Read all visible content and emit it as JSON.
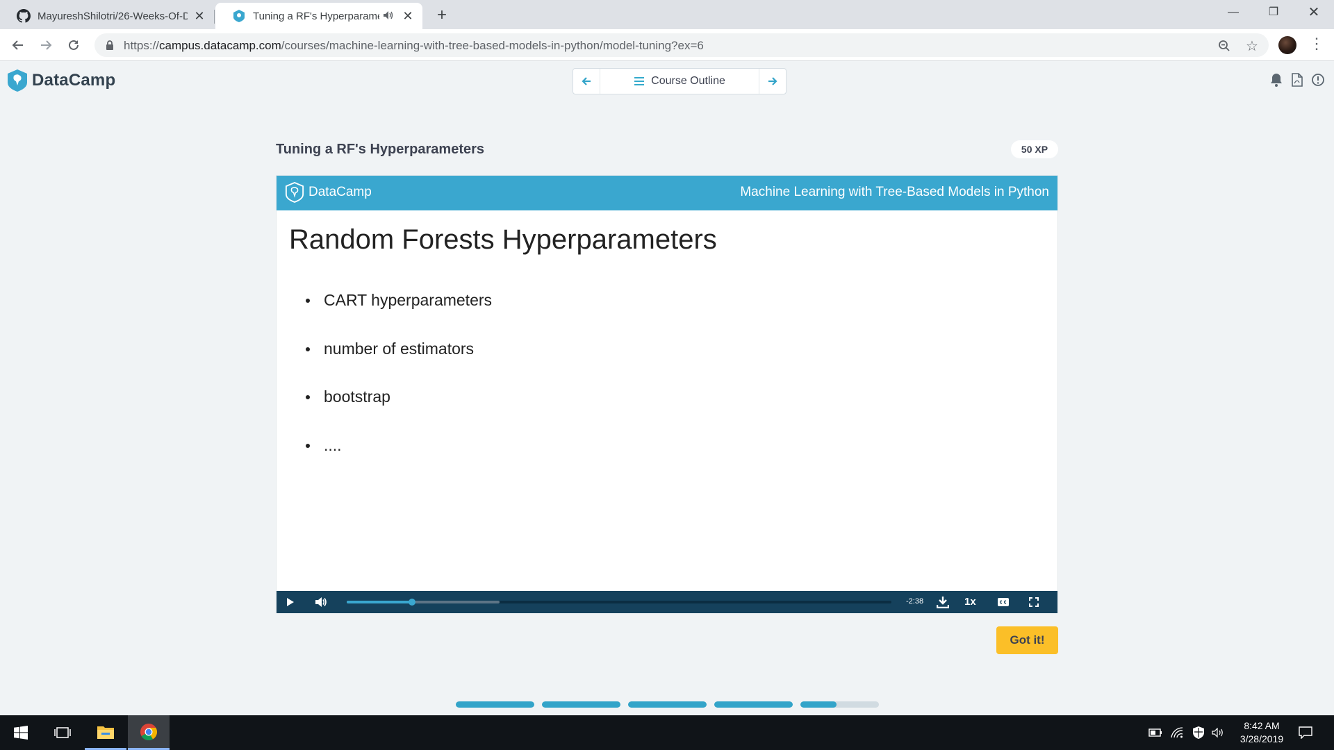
{
  "browser": {
    "tabs": [
      {
        "title": "MayureshShilotri/26-Weeks-Of-D",
        "icon": "github-icon",
        "active": false
      },
      {
        "title": "Tuning a RF's Hyperparamet",
        "icon": "datacamp-icon",
        "active": true,
        "audio": true
      }
    ],
    "url": {
      "scheme": "https://",
      "host": "campus.datacamp.com",
      "path": "/courses/machine-learning-with-tree-based-models-in-python/model-tuning?ex=6"
    }
  },
  "header": {
    "brand": "DataCamp",
    "nav": {
      "center_label": "Course Outline"
    },
    "icons": [
      "bell-icon",
      "pdf-icon",
      "alert-icon"
    ]
  },
  "exercise": {
    "title": "Tuning a RF's Hyperparameters",
    "xp": "50 XP"
  },
  "slide": {
    "brand": "DataCamp",
    "course": "Machine Learning with Tree-Based Models in Python",
    "title": "Random Forests Hyperparameters",
    "bullets": [
      "CART hyperparameters",
      "number of estimators",
      "bootstrap",
      "...."
    ]
  },
  "player": {
    "time_remaining": "-2:38",
    "speed": "1x",
    "played_fraction": 0.12,
    "buffered_fraction": 0.28
  },
  "actions": {
    "got_it": "Got it!"
  },
  "progress": {
    "segments": [
      1,
      1,
      1,
      1,
      0.46
    ]
  },
  "taskbar": {
    "time": "8:42 AM",
    "date": "3/28/2019"
  },
  "colors": {
    "brand_blue": "#3aa7cf",
    "player_bg": "#15415c",
    "cta_yellow": "#fbbf28"
  }
}
